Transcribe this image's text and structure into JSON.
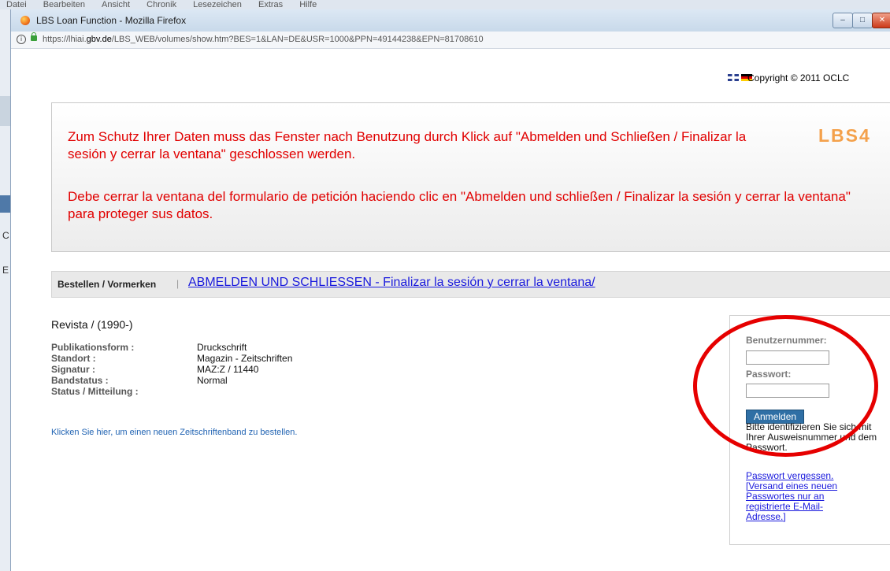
{
  "background_app": {
    "menu_items": [
      "Datei",
      "Bearbeiten",
      "Ansicht",
      "Chronik",
      "Lesezeichen",
      "Extras",
      "Hilfe"
    ],
    "side_letters": [
      "C",
      "E"
    ]
  },
  "window": {
    "title": "LBS Loan Function - Mozilla Firefox",
    "url_prefix": "https://lhiai.",
    "url_domain": "gbv.de",
    "url_rest": "/LBS_WEB/volumes/show.htm?BES=1&LAN=DE&USR=1000&PPN=49144238&EPN=81708610"
  },
  "header": {
    "copyright": "Copyright © 2011 OCLC"
  },
  "banner": {
    "text_de": "Zum Schutz Ihrer Daten muss das Fenster nach Benutzung durch Klick auf \"Abmelden und Schließen / Finalizar la sesión y cerrar la ventana\" geschlossen werden.",
    "text_es": "Debe cerrar la ventana del formulario de petición haciendo clic en \"Abmelden und schließen / Finalizar la sesión y cerrar la ventana\" para proteger sus datos.",
    "logo": "LBS4"
  },
  "nav": {
    "label": "Bestellen / Vormerken",
    "separator": "|",
    "logout_link": "ABMELDEN UND SCHLIESSEN - Finalizar la sesión y cerrar la ventana/"
  },
  "record": {
    "title": "Revista / (1990-)",
    "fields": [
      {
        "key": "Publikationsform :",
        "value": "Druckschrift"
      },
      {
        "key": "Standort :",
        "value": "Magazin - Zeitschriften"
      },
      {
        "key": "Signatur :",
        "value": "MAZ:Z / 11440"
      },
      {
        "key": "Bandstatus :",
        "value": "Normal"
      },
      {
        "key": "Status / Mitteilung :",
        "value": ""
      }
    ],
    "new_volume_link": "Klicken Sie hier, um einen neuen Zeitschriftenband zu bestellen."
  },
  "login": {
    "user_label": "Benutzernummer:",
    "user_value": "",
    "password_label": "Passwort:",
    "password_value": "",
    "button": "Anmelden",
    "hint": "Bitte identifizieren Sie sich mit Ihrer Ausweisnummer und dem Passwort.",
    "forgot_link": "Passwort vergessen. [Versand eines neuen Passwortes nur an registrierte E-Mail-Adresse.]"
  },
  "colors": {
    "banner_text": "#e10000",
    "link": "#1a1add",
    "annotation": "#e60000",
    "logo": "#f4a14b"
  }
}
